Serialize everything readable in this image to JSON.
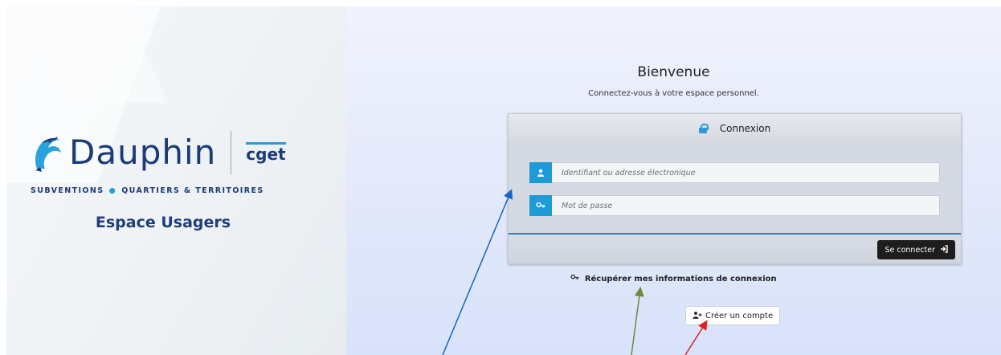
{
  "brand": {
    "name": "Dauphin",
    "partner": "cget",
    "tagline_part1": "SUBVENTIONS",
    "tagline_part2": "QUARTIERS & TERRITOIRES",
    "space": "Espace Usagers"
  },
  "welcome": {
    "title": "Bienvenue",
    "subtitle": "Connectez-vous à votre espace personnel."
  },
  "login": {
    "header": "Connexion",
    "username_placeholder": "Identifiant ou adresse électronique",
    "password_placeholder": "Mot de passe",
    "submit_label": "Se connecter"
  },
  "links": {
    "recover": "Récupérer mes informations de connexion",
    "create_account": "Créer un compte"
  },
  "colors": {
    "accent": "#1e9ad6",
    "brand_navy": "#1b3a78",
    "arrow_blue": "#1565c0",
    "arrow_green": "#6a8c3a",
    "arrow_red": "#e02020"
  },
  "icons": {
    "lock": "lock-icon",
    "user": "user-icon",
    "key": "key-icon",
    "sign_in": "sign-in-icon",
    "user_plus": "user-plus-icon"
  }
}
